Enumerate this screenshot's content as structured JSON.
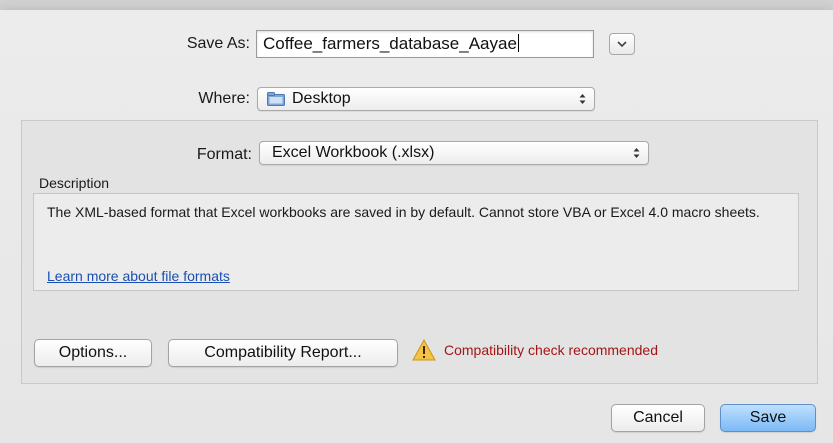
{
  "save_as": {
    "label": "Save As:",
    "filename": "Coffee_farmers_database_Aayae"
  },
  "where": {
    "label": "Where:",
    "value": "Desktop",
    "icon": "folder-icon"
  },
  "format": {
    "label": "Format:",
    "value": "Excel Workbook (.xlsx)"
  },
  "description": {
    "label": "Description",
    "text": "The XML-based format that Excel workbooks are saved in by default. Cannot store VBA or Excel 4.0 macro sheets.",
    "link": "Learn more about file formats"
  },
  "buttons": {
    "options": "Options...",
    "compatibility_report": "Compatibility Report...",
    "cancel": "Cancel",
    "save": "Save"
  },
  "warning": {
    "icon": "warning-icon",
    "text": "Compatibility check recommended",
    "color": "#a51515"
  },
  "colors": {
    "accent": "#7cb9f5",
    "link": "#1a4fb5"
  }
}
